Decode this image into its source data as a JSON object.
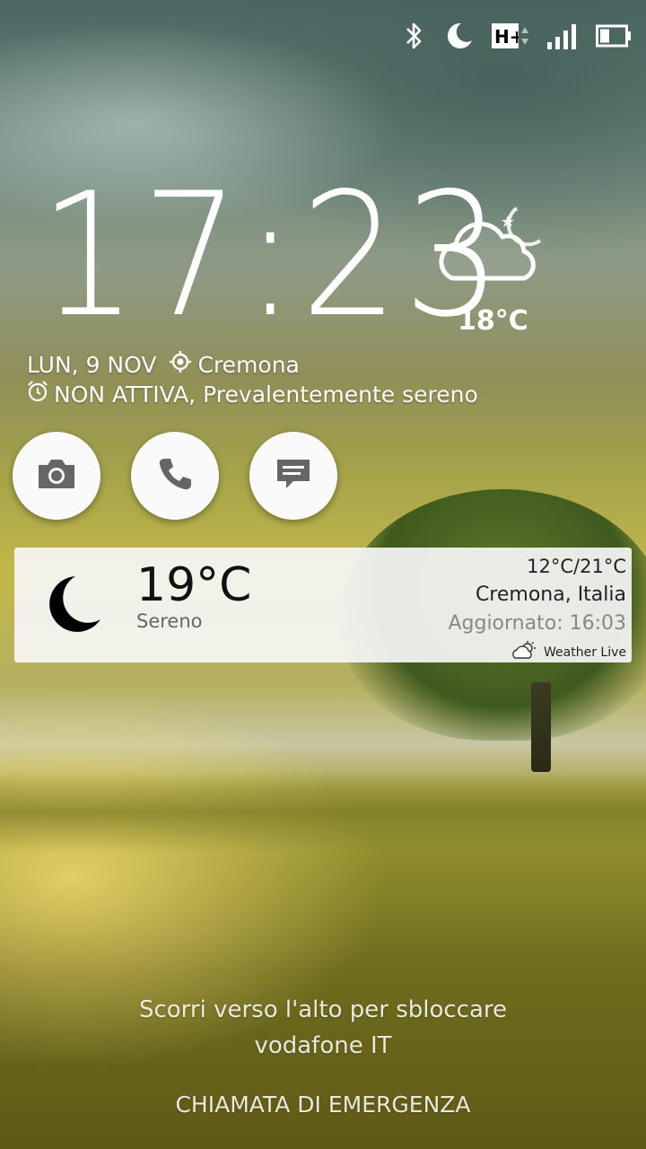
{
  "status_bar": {
    "icons": [
      "bluetooth-icon",
      "moon-icon",
      "network-hplus-icon",
      "signal-icon",
      "battery-icon"
    ],
    "network_type": "H+"
  },
  "lockscreen": {
    "time": "17:23",
    "weather_temp": "18°C",
    "date": "LUN, 9 NOV",
    "location": "Cremona",
    "alarm_status": "NON ATTIVA, Prevalentemente sereno"
  },
  "shortcuts": [
    {
      "icon": "camera-icon"
    },
    {
      "icon": "phone-icon"
    },
    {
      "icon": "message-icon"
    }
  ],
  "weather_widget": {
    "temperature": "19°C",
    "condition": "Sereno",
    "min_max": "12°C/21°C",
    "city": "Cremona, Italia",
    "updated": "Aggiornato: 16:03",
    "brand": "Weather Live"
  },
  "footer": {
    "unlock_hint": "Scorri verso l'alto per sbloccare",
    "carrier": "vodafone IT",
    "emergency": "CHIAMATA DI EMERGENZA"
  }
}
